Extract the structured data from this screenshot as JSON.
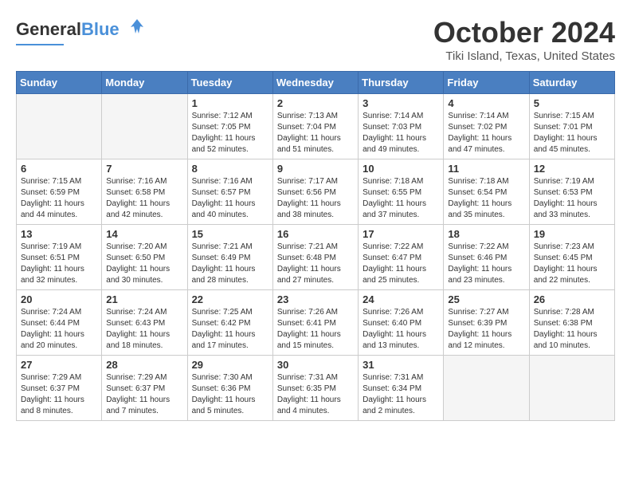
{
  "header": {
    "logo_general": "General",
    "logo_blue": "Blue",
    "month": "October 2024",
    "location": "Tiki Island, Texas, United States"
  },
  "days_of_week": [
    "Sunday",
    "Monday",
    "Tuesday",
    "Wednesday",
    "Thursday",
    "Friday",
    "Saturday"
  ],
  "weeks": [
    [
      {
        "day": "",
        "empty": true
      },
      {
        "day": "",
        "empty": true
      },
      {
        "day": "1",
        "sunrise": "7:12 AM",
        "sunset": "7:05 PM",
        "daylight": "11 hours and 52 minutes."
      },
      {
        "day": "2",
        "sunrise": "7:13 AM",
        "sunset": "7:04 PM",
        "daylight": "11 hours and 51 minutes."
      },
      {
        "day": "3",
        "sunrise": "7:14 AM",
        "sunset": "7:03 PM",
        "daylight": "11 hours and 49 minutes."
      },
      {
        "day": "4",
        "sunrise": "7:14 AM",
        "sunset": "7:02 PM",
        "daylight": "11 hours and 47 minutes."
      },
      {
        "day": "5",
        "sunrise": "7:15 AM",
        "sunset": "7:01 PM",
        "daylight": "11 hours and 45 minutes."
      }
    ],
    [
      {
        "day": "6",
        "sunrise": "7:15 AM",
        "sunset": "6:59 PM",
        "daylight": "11 hours and 44 minutes."
      },
      {
        "day": "7",
        "sunrise": "7:16 AM",
        "sunset": "6:58 PM",
        "daylight": "11 hours and 42 minutes."
      },
      {
        "day": "8",
        "sunrise": "7:16 AM",
        "sunset": "6:57 PM",
        "daylight": "11 hours and 40 minutes."
      },
      {
        "day": "9",
        "sunrise": "7:17 AM",
        "sunset": "6:56 PM",
        "daylight": "11 hours and 38 minutes."
      },
      {
        "day": "10",
        "sunrise": "7:18 AM",
        "sunset": "6:55 PM",
        "daylight": "11 hours and 37 minutes."
      },
      {
        "day": "11",
        "sunrise": "7:18 AM",
        "sunset": "6:54 PM",
        "daylight": "11 hours and 35 minutes."
      },
      {
        "day": "12",
        "sunrise": "7:19 AM",
        "sunset": "6:53 PM",
        "daylight": "11 hours and 33 minutes."
      }
    ],
    [
      {
        "day": "13",
        "sunrise": "7:19 AM",
        "sunset": "6:51 PM",
        "daylight": "11 hours and 32 minutes."
      },
      {
        "day": "14",
        "sunrise": "7:20 AM",
        "sunset": "6:50 PM",
        "daylight": "11 hours and 30 minutes."
      },
      {
        "day": "15",
        "sunrise": "7:21 AM",
        "sunset": "6:49 PM",
        "daylight": "11 hours and 28 minutes."
      },
      {
        "day": "16",
        "sunrise": "7:21 AM",
        "sunset": "6:48 PM",
        "daylight": "11 hours and 27 minutes."
      },
      {
        "day": "17",
        "sunrise": "7:22 AM",
        "sunset": "6:47 PM",
        "daylight": "11 hours and 25 minutes."
      },
      {
        "day": "18",
        "sunrise": "7:22 AM",
        "sunset": "6:46 PM",
        "daylight": "11 hours and 23 minutes."
      },
      {
        "day": "19",
        "sunrise": "7:23 AM",
        "sunset": "6:45 PM",
        "daylight": "11 hours and 22 minutes."
      }
    ],
    [
      {
        "day": "20",
        "sunrise": "7:24 AM",
        "sunset": "6:44 PM",
        "daylight": "11 hours and 20 minutes."
      },
      {
        "day": "21",
        "sunrise": "7:24 AM",
        "sunset": "6:43 PM",
        "daylight": "11 hours and 18 minutes."
      },
      {
        "day": "22",
        "sunrise": "7:25 AM",
        "sunset": "6:42 PM",
        "daylight": "11 hours and 17 minutes."
      },
      {
        "day": "23",
        "sunrise": "7:26 AM",
        "sunset": "6:41 PM",
        "daylight": "11 hours and 15 minutes."
      },
      {
        "day": "24",
        "sunrise": "7:26 AM",
        "sunset": "6:40 PM",
        "daylight": "11 hours and 13 minutes."
      },
      {
        "day": "25",
        "sunrise": "7:27 AM",
        "sunset": "6:39 PM",
        "daylight": "11 hours and 12 minutes."
      },
      {
        "day": "26",
        "sunrise": "7:28 AM",
        "sunset": "6:38 PM",
        "daylight": "11 hours and 10 minutes."
      }
    ],
    [
      {
        "day": "27",
        "sunrise": "7:29 AM",
        "sunset": "6:37 PM",
        "daylight": "11 hours and 8 minutes."
      },
      {
        "day": "28",
        "sunrise": "7:29 AM",
        "sunset": "6:37 PM",
        "daylight": "11 hours and 7 minutes."
      },
      {
        "day": "29",
        "sunrise": "7:30 AM",
        "sunset": "6:36 PM",
        "daylight": "11 hours and 5 minutes."
      },
      {
        "day": "30",
        "sunrise": "7:31 AM",
        "sunset": "6:35 PM",
        "daylight": "11 hours and 4 minutes."
      },
      {
        "day": "31",
        "sunrise": "7:31 AM",
        "sunset": "6:34 PM",
        "daylight": "11 hours and 2 minutes."
      },
      {
        "day": "",
        "empty": true
      },
      {
        "day": "",
        "empty": true
      }
    ]
  ],
  "labels": {
    "sunrise": "Sunrise:",
    "sunset": "Sunset:",
    "daylight": "Daylight:"
  }
}
